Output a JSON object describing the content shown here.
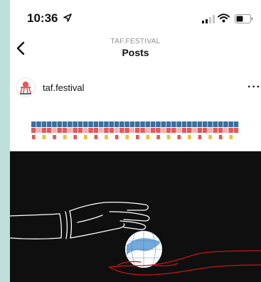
{
  "status_bar": {
    "time": "10:36",
    "icons": [
      "location-arrow-icon",
      "signal-icon",
      "wifi-icon",
      "battery-icon"
    ]
  },
  "nav": {
    "back_icon": "chevron-left-icon",
    "subtitle": "TAF.FESTIVAL",
    "title": "Posts"
  },
  "post": {
    "username": "taf.festival",
    "more_icon": "more-horizontal-icon",
    "more_label": "···"
  },
  "colors": {
    "background": "#bfdfdc",
    "banner_blue": "#3c6e9e",
    "banner_red": "#e05a5a",
    "banner_yellow": "#e8c233",
    "illustration_bg": "#0f0f0f",
    "hand_red": "#c8141a"
  }
}
